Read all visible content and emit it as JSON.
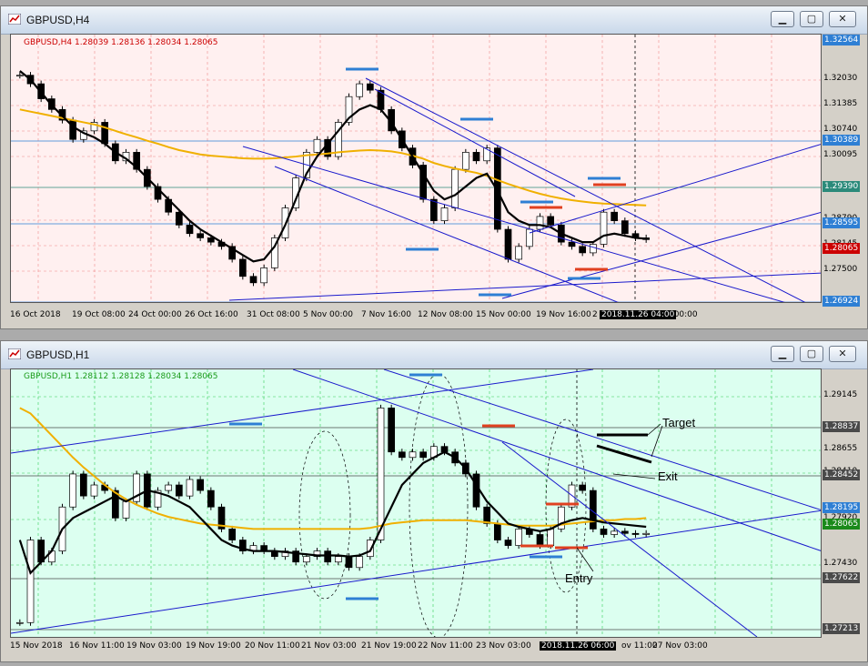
{
  "windows": [
    {
      "title": "GBPUSD,H4",
      "info": "GBPUSD,H4  1.28039 1.28136 1.28034 1.28065",
      "info_color": "#cc0000",
      "theme": {
        "bg": "#fff0f0",
        "grid": "#f08a8a"
      },
      "price_labels": [
        "1.32030",
        "1.31385",
        "1.30740",
        "1.30095",
        "1.28790",
        "1.28145",
        "1.27500"
      ],
      "boxed_labels": [
        {
          "text": "1.32564",
          "color": "#2e7fd4"
        },
        {
          "text": "1.30389",
          "color": "#2e7fd4"
        },
        {
          "text": "1.29390",
          "color": "#2b8a7a"
        },
        {
          "text": "1.28595",
          "color": "#2e7fd4"
        },
        {
          "text": "1.28065",
          "color": "#cc0000"
        },
        {
          "text": "1.26924",
          "color": "#2e7fd4"
        }
      ],
      "time_labels": [
        "16 Oct 2018",
        "19 Oct 08:00",
        "24 Oct 00:00",
        "26 Oct 16:00",
        "31 Oct 08:00",
        "5 Nov 00:00",
        "7 Nov 16:00",
        "12 Nov 08:00",
        "15 Nov 00:00",
        "19 Nov 16:00",
        "2",
        "ov 00:00"
      ],
      "cursor_time": "2018.11.26 04:00",
      "chart_data": {
        "type": "candlestick",
        "ylim": [
          1.266,
          1.3285
        ],
        "close": [
          1.319,
          1.317,
          1.3135,
          1.311,
          1.3085,
          1.304,
          1.306,
          1.308,
          1.303,
          1.299,
          1.301,
          1.297,
          1.293,
          1.29,
          1.287,
          1.284,
          1.282,
          1.281,
          1.28,
          1.279,
          1.276,
          1.272,
          1.2705,
          1.274,
          1.281,
          1.288,
          1.295,
          1.301,
          1.304,
          1.3,
          1.308,
          1.314,
          1.317,
          1.3155,
          1.311,
          1.306,
          1.302,
          1.298,
          1.29,
          1.285,
          1.288,
          1.297,
          1.301,
          1.299,
          1.302,
          1.283,
          1.276,
          1.279,
          1.283,
          1.286,
          1.284,
          1.28,
          1.279,
          1.2775,
          1.2795,
          1.287,
          1.285,
          1.282,
          1.281,
          1.2806
        ],
        "ma_fast": [
          1.32,
          1.318,
          1.315,
          1.312,
          1.3095,
          1.307,
          1.3055,
          1.3045,
          1.303,
          1.301,
          1.2995,
          1.2975,
          1.295,
          1.2925,
          1.29,
          1.2875,
          1.285,
          1.283,
          1.2815,
          1.28,
          1.2785,
          1.277,
          1.2755,
          1.276,
          1.279,
          1.284,
          1.29,
          1.296,
          1.3,
          1.303,
          1.306,
          1.309,
          1.311,
          1.312,
          1.311,
          1.308,
          1.304,
          1.3,
          1.296,
          1.292,
          1.29,
          1.291,
          1.293,
          1.295,
          1.296,
          1.292,
          1.287,
          1.285,
          1.284,
          1.284,
          1.2835,
          1.282,
          1.281,
          1.28,
          1.28,
          1.2815,
          1.282,
          1.2815,
          1.281,
          1.2808
        ],
        "ma_slow": [
          1.311,
          1.3105,
          1.31,
          1.3095,
          1.309,
          1.3085,
          1.308,
          1.3075,
          1.3068,
          1.306,
          1.3052,
          1.3045,
          1.3037,
          1.303,
          1.3022,
          1.3015,
          1.301,
          1.3005,
          1.3002,
          1.3,
          1.2998,
          1.2996,
          1.2995,
          1.2995,
          1.2996,
          1.2998,
          1.3,
          1.3003,
          1.3005,
          1.3007,
          1.301,
          1.3012,
          1.3014,
          1.3015,
          1.3014,
          1.3012,
          1.3008,
          1.3002,
          1.2995,
          1.2985,
          1.2978,
          1.2972,
          1.2967,
          1.2962,
          1.2955,
          1.2945,
          1.2936,
          1.2928,
          1.292,
          1.2913,
          1.2907,
          1.2902,
          1.2898,
          1.2895,
          1.2892,
          1.289,
          1.2889,
          1.2888,
          1.2887,
          1.2886
        ]
      }
    },
    {
      "title": "GBPUSD,H1",
      "info": "GBPUSD,H1  1.28112 1.28128 1.28034 1.28065",
      "info_color": "#1a9a1a",
      "theme": {
        "bg": "#dcfff0",
        "grid": "#33cc55"
      },
      "price_labels": [
        "1.29145",
        "1.28655",
        "1.28410",
        "1.27920",
        "1.27430"
      ],
      "boxed_labels": [
        {
          "text": "1.28837",
          "color": "#4a4a4a"
        },
        {
          "text": "1.28452",
          "color": "#4a4a4a"
        },
        {
          "text": "1.28195",
          "color": "#2e7fd4"
        },
        {
          "text": "1.28065",
          "color": "#1a8a1a"
        },
        {
          "text": "1.27622",
          "color": "#4a4a4a"
        },
        {
          "text": "1.27213",
          "color": "#4a4a4a"
        }
      ],
      "time_labels": [
        "15 Nov 2018",
        "16 Nov 11:00",
        "19 Nov 03:00",
        "19 Nov 19:00",
        "20 Nov 11:00",
        "21 Nov 03:00",
        "21 Nov 19:00",
        "22 Nov 11:00",
        "23 Nov 03:00",
        "ov 11:00",
        "27 Nov 03:00"
      ],
      "cursor_time": "2018.11.26 06:00",
      "annotations": {
        "target": "Target",
        "exit": "Exit",
        "entry": "Entry"
      },
      "chart_data": {
        "type": "candlestick",
        "ylim": [
          1.2712,
          1.2955
        ],
        "close": [
          1.2725,
          1.28,
          1.278,
          1.279,
          1.283,
          1.286,
          1.284,
          1.285,
          1.2845,
          1.282,
          1.2835,
          1.286,
          1.283,
          1.2845,
          1.285,
          1.284,
          1.2855,
          1.2845,
          1.283,
          1.281,
          1.28,
          1.279,
          1.2795,
          1.279,
          1.2785,
          1.279,
          1.278,
          1.2785,
          1.279,
          1.278,
          1.2785,
          1.2775,
          1.2785,
          1.28,
          1.292,
          1.288,
          1.2875,
          1.288,
          1.2875,
          1.2885,
          1.288,
          1.287,
          1.286,
          1.283,
          1.2815,
          1.28,
          1.2795,
          1.281,
          1.2805,
          1.2795,
          1.281,
          1.283,
          1.285,
          1.2845,
          1.281,
          1.2805,
          1.2808,
          1.2806,
          1.2805,
          1.2806
        ],
        "ma_fast": [
          1.28,
          1.277,
          1.278,
          1.279,
          1.281,
          1.282,
          1.2825,
          1.283,
          1.2835,
          1.284,
          1.2835,
          1.284,
          1.2845,
          1.2843,
          1.284,
          1.2835,
          1.283,
          1.282,
          1.281,
          1.28,
          1.2795,
          1.2792,
          1.279,
          1.279,
          1.279,
          1.2789,
          1.2788,
          1.2787,
          1.2786,
          1.2786,
          1.2786,
          1.2785,
          1.2786,
          1.279,
          1.281,
          1.283,
          1.285,
          1.286,
          1.287,
          1.2875,
          1.288,
          1.2875,
          1.2865,
          1.285,
          1.2835,
          1.2825,
          1.2815,
          1.2812,
          1.281,
          1.2808,
          1.281,
          1.2815,
          1.2818,
          1.282,
          1.2818,
          1.2816,
          1.2815,
          1.2814,
          1.2813,
          1.2812
        ],
        "ma_slow": [
          1.292,
          1.2915,
          1.2905,
          1.2895,
          1.2885,
          1.2875,
          1.2866,
          1.2858,
          1.285,
          1.2843,
          1.2837,
          1.2832,
          1.2828,
          1.2824,
          1.2821,
          1.2819,
          1.2817,
          1.2815,
          1.2814,
          1.2813,
          1.2812,
          1.2811,
          1.281,
          1.281,
          1.281,
          1.281,
          1.281,
          1.281,
          1.281,
          1.281,
          1.281,
          1.281,
          1.281,
          1.2811,
          1.2813,
          1.2815,
          1.2816,
          1.2817,
          1.2818,
          1.2818,
          1.2818,
          1.2818,
          1.2818,
          1.2817,
          1.2816,
          1.2815,
          1.2814,
          1.2813,
          1.2813,
          1.2813,
          1.2813,
          1.2814,
          1.2815,
          1.2816,
          1.2817,
          1.2818,
          1.2818,
          1.2819,
          1.2819,
          1.282
        ]
      }
    }
  ]
}
